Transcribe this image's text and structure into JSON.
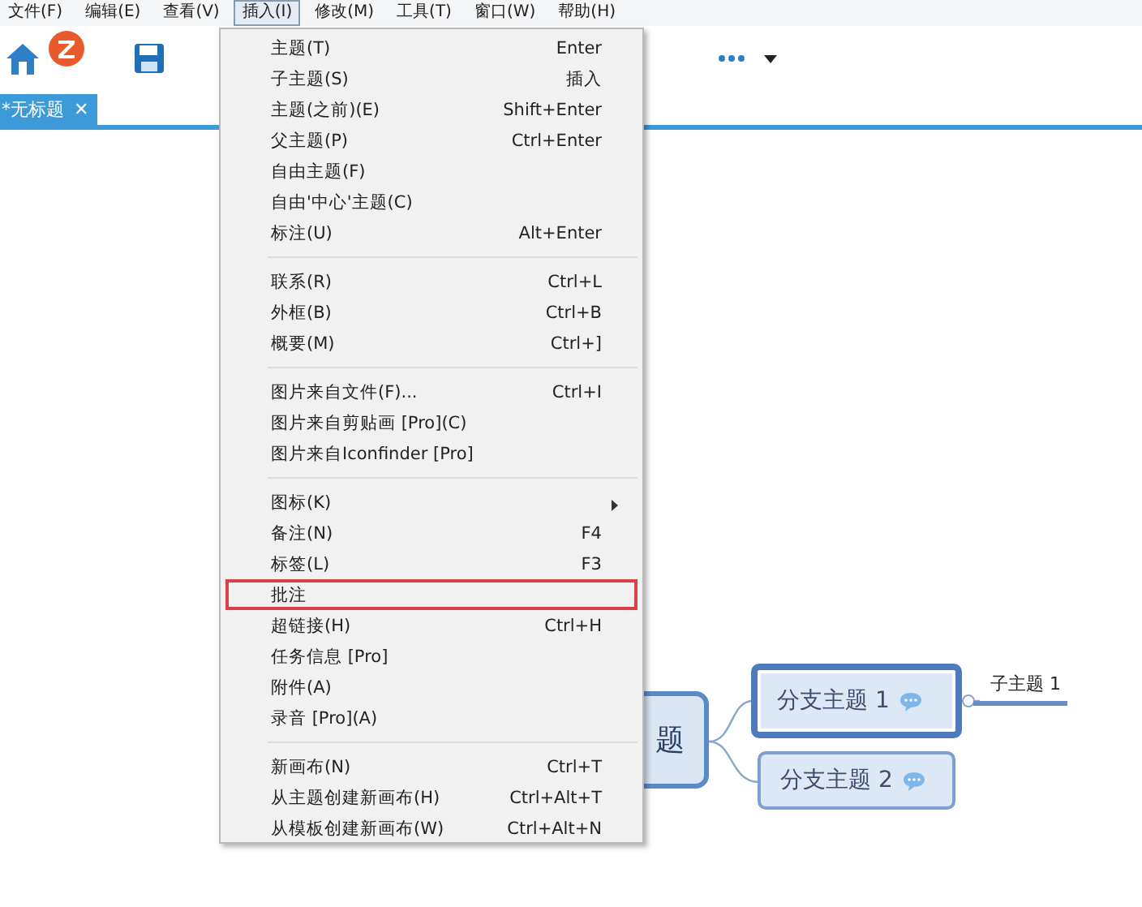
{
  "menubar": [
    {
      "label": "文件(F)",
      "selected": false
    },
    {
      "label": "编辑(E)",
      "selected": false
    },
    {
      "label": "查看(V)",
      "selected": false
    },
    {
      "label": "插入(I)",
      "selected": true
    },
    {
      "label": "修改(M)",
      "selected": false
    },
    {
      "label": "工具(T)",
      "selected": false
    },
    {
      "label": "窗口(W)",
      "selected": false
    },
    {
      "label": "帮助(H)",
      "selected": false
    }
  ],
  "tabs": [
    {
      "label": "*无标题",
      "close": "✕",
      "selected": true
    }
  ],
  "menu": {
    "groups": [
      [
        {
          "label": "主题(T)",
          "shortcut": "Enter",
          "highlighted": false,
          "submenu": false
        },
        {
          "label": "子主题(S)",
          "shortcut": "插入",
          "highlighted": false,
          "submenu": false
        },
        {
          "label": "主题(之前)(E)",
          "shortcut": "Shift+Enter",
          "highlighted": false,
          "submenu": false
        },
        {
          "label": "父主题(P)",
          "shortcut": "Ctrl+Enter",
          "highlighted": false,
          "submenu": false
        },
        {
          "label": "自由主题(F)",
          "highlighted": false,
          "submenu": false
        },
        {
          "label": "自由'中心'主题(C)",
          "highlighted": false,
          "submenu": false
        },
        {
          "label": "标注(U)",
          "shortcut": "Alt+Enter",
          "highlighted": false,
          "submenu": false
        }
      ],
      [
        {
          "label": "联系(R)",
          "shortcut": "Ctrl+L",
          "highlighted": false,
          "submenu": false
        },
        {
          "label": "外框(B)",
          "shortcut": "Ctrl+B",
          "highlighted": false,
          "submenu": false
        },
        {
          "label": "概要(M)",
          "shortcut": "Ctrl+]",
          "highlighted": false,
          "submenu": false
        }
      ],
      [
        {
          "label": "图片来自文件(F)...",
          "shortcut": "Ctrl+I",
          "highlighted": false,
          "submenu": false
        },
        {
          "label": "图片来自剪贴画 [Pro](C)",
          "highlighted": false,
          "submenu": false
        },
        {
          "label": "图片来自Iconfinder [Pro]",
          "highlighted": false,
          "submenu": false
        }
      ],
      [
        {
          "label": "图标(K)",
          "highlighted": false,
          "submenu": true
        },
        {
          "label": "备注(N)",
          "shortcut": "F4",
          "highlighted": false,
          "submenu": false
        },
        {
          "label": "标签(L)",
          "shortcut": "F3",
          "highlighted": false,
          "submenu": false
        },
        {
          "label": "批注",
          "highlighted": true,
          "submenu": false
        },
        {
          "label": "超链接(H)",
          "shortcut": "Ctrl+H",
          "highlighted": false,
          "submenu": false
        },
        {
          "label": "任务信息 [Pro]",
          "highlighted": false,
          "submenu": false
        },
        {
          "label": "附件(A)",
          "highlighted": false,
          "submenu": false
        },
        {
          "label": "录音 [Pro](A)",
          "highlighted": false,
          "submenu": false
        }
      ],
      [
        {
          "label": "新画布(N)",
          "shortcut": "Ctrl+T",
          "highlighted": false,
          "submenu": false
        },
        {
          "label": "从主题创建新画布(H)",
          "shortcut": "Ctrl+Alt+T",
          "highlighted": false,
          "submenu": false
        },
        {
          "label": "从模板创建新画布(W)",
          "shortcut": "Ctrl+Alt+N",
          "highlighted": false,
          "submenu": false
        }
      ]
    ]
  },
  "mindmap": {
    "central": {
      "label": "题"
    },
    "branches": [
      {
        "label": "分支主题 1",
        "selected": true,
        "comment": true
      },
      {
        "label": "分支主题 2",
        "selected": false,
        "comment": true
      }
    ],
    "subtopics": [
      {
        "label": "子主题 1"
      }
    ]
  }
}
